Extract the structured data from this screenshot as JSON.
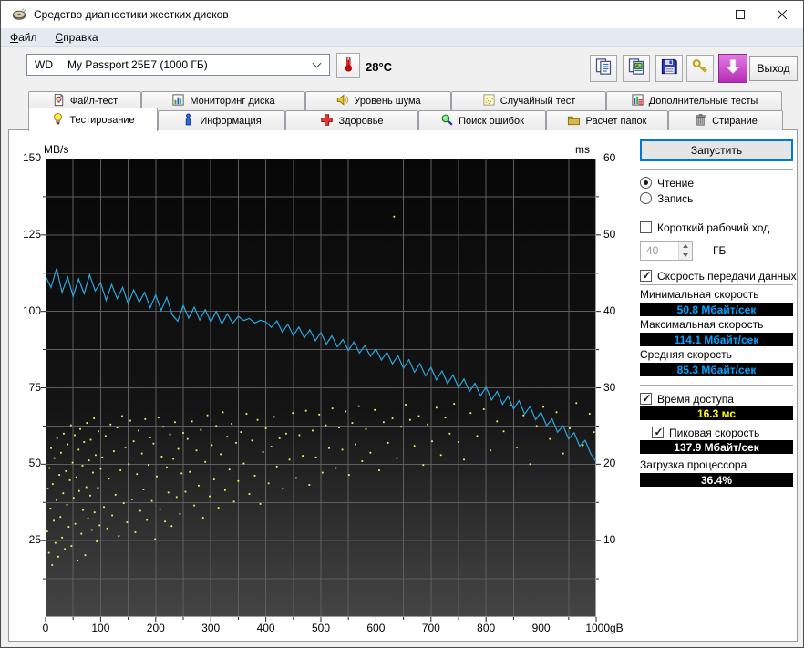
{
  "window": {
    "title": "Средство диагностики жестких дисков",
    "menu": [
      {
        "key": "Ф",
        "rest": "айл"
      },
      {
        "key": "С",
        "rest": "правка"
      }
    ]
  },
  "toolbar": {
    "drive": {
      "vendor": "WD",
      "model": "My Passport 25E7 (1000 ГБ)"
    },
    "temperature": "28°C",
    "buttons": [
      {
        "name": "copy-text-button",
        "icon": "copy-text-icon"
      },
      {
        "name": "copy-image-button",
        "icon": "copy-image-icon"
      },
      {
        "name": "save-button",
        "icon": "save-icon"
      },
      {
        "name": "keys-button",
        "icon": "keys-icon"
      },
      {
        "name": "download-button",
        "icon": "download-arrow-icon",
        "style": "magenta"
      }
    ],
    "exit_label": "Выход"
  },
  "tab_rows": [
    {
      "items": [
        {
          "label": "Файл-тест",
          "icon": "file-test-icon"
        },
        {
          "label": "Мониторинг диска",
          "icon": "disk-monitor-icon"
        },
        {
          "label": "Уровень шума",
          "icon": "noise-level-icon"
        },
        {
          "label": "Случайный тест",
          "icon": "random-test-icon"
        },
        {
          "label": "Дополнительные тесты",
          "icon": "extra-tests-icon"
        }
      ]
    },
    {
      "items": [
        {
          "label": "Тестирование",
          "icon": "benchmark-icon",
          "active": true
        },
        {
          "label": "Информация",
          "icon": "info-icon"
        },
        {
          "label": "Здоровье",
          "icon": "health-icon"
        },
        {
          "label": "Поиск ошибок",
          "icon": "error-scan-icon"
        },
        {
          "label": "Расчет папок",
          "icon": "folder-usage-icon"
        },
        {
          "label": "Стирание",
          "icon": "erase-icon"
        }
      ]
    }
  ],
  "controls": {
    "start_button": "Запустить",
    "mode": {
      "read": "Чтение",
      "write": "Запись",
      "read_selected": true,
      "write_selected": false
    },
    "short_stroke": {
      "label": "Короткий рабочий ход",
      "checked": false,
      "value": "40",
      "unit": "ГБ"
    },
    "transfer": {
      "label": "Скорость передачи данных",
      "checked": true,
      "min_label": "Минимальная скорость",
      "min_value": "50.8 Мбайт/сек",
      "max_label": "Максимальная скорость",
      "max_value": "114.1 Мбайт/сек",
      "avg_label": "Средняя скорость",
      "avg_value": "85.3 Мбайт/сек"
    },
    "access_time": {
      "label": "Время доступа",
      "checked": true,
      "value": "16.3 мс"
    },
    "burst": {
      "label": "Пиковая скорость",
      "checked": true,
      "value": "137.9 Мбайт/сек"
    },
    "cpu": {
      "label": "Загрузка процессора",
      "value": "36.4%"
    }
  },
  "colors": {
    "accent": "#0078d7",
    "speed_value": "#00a2ff",
    "access_value": "#ffff00",
    "white_value": "#ffffff",
    "plot_grid": "#5e5e5e"
  },
  "chart_data": {
    "type": "line+scatter",
    "x_axis": {
      "min": 0,
      "max": 1000,
      "tick_step": 100,
      "grid_step": 50,
      "tick_labels": [
        "0",
        "100",
        "200",
        "300",
        "400",
        "500",
        "600",
        "700",
        "800",
        "900",
        "1000gB"
      ]
    },
    "y_left": {
      "label": "MB/s",
      "min": 0,
      "max": 150,
      "grid_step": 12.5,
      "tick_values": [
        150,
        125,
        100,
        75,
        50,
        25
      ]
    },
    "y_right": {
      "label": "ms",
      "min": 0,
      "max": 60,
      "tick_values": [
        60,
        50,
        40,
        30,
        20,
        10
      ]
    },
    "series": [
      {
        "name": "transfer-rate",
        "unit": "MB/s",
        "color": "#2ba7df",
        "x_start": 0,
        "x_step": 10,
        "values": [
          111.5,
          107.8,
          114.1,
          106.2,
          111.3,
          104.9,
          110.6,
          105.8,
          112.0,
          106.7,
          109.4,
          103.6,
          108.8,
          104.2,
          107.9,
          102.4,
          107.0,
          103.0,
          106.2,
          101.2,
          105.4,
          100.3,
          104.6,
          98.9,
          96.8,
          102.0,
          97.8,
          101.4,
          97.2,
          100.6,
          96.5,
          100.0,
          95.9,
          99.2,
          96.1,
          98.4,
          97.0,
          97.7,
          96.2,
          97.1,
          96.6,
          94.8,
          96.9,
          93.2,
          95.8,
          92.1,
          94.9,
          91.3,
          94.0,
          90.4,
          93.1,
          89.3,
          92.0,
          88.4,
          90.8,
          87.2,
          90.0,
          86.4,
          88.8,
          85.3,
          87.7,
          84.1,
          86.6,
          82.8,
          85.5,
          81.4,
          84.2,
          80.1,
          82.9,
          78.9,
          81.7,
          77.6,
          80.5,
          76.4,
          79.2,
          75.1,
          77.9,
          73.8,
          76.5,
          72.4,
          75.2,
          71.0,
          73.8,
          69.6,
          72.3,
          68.1,
          70.8,
          66.4,
          68.9,
          64.6,
          67.0,
          62.6,
          64.8,
          60.5,
          62.6,
          58.2,
          60.3,
          55.9,
          57.8,
          53.4,
          50.8
        ]
      },
      {
        "name": "access-time",
        "unit": "ms",
        "color": "#f5f360",
        "points": [
          [
            3,
            11.2
          ],
          [
            4,
            16.8
          ],
          [
            6,
            8.4
          ],
          [
            7,
            19.5
          ],
          [
            9,
            14.2
          ],
          [
            10,
            22.1
          ],
          [
            12,
            6.8
          ],
          [
            13,
            17.4
          ],
          [
            15,
            12.6
          ],
          [
            16,
            20.8
          ],
          [
            18,
            9.7
          ],
          [
            20,
            15.3
          ],
          [
            21,
            23.4
          ],
          [
            23,
            7.9
          ],
          [
            25,
            18.6
          ],
          [
            27,
            13.1
          ],
          [
            28,
            21.5
          ],
          [
            30,
            10.4
          ],
          [
            32,
            16.2
          ],
          [
            33,
            24.0
          ],
          [
            35,
            8.9
          ],
          [
            37,
            19.1
          ],
          [
            39,
            14.7
          ],
          [
            40,
            22.6
          ],
          [
            42,
            11.8
          ],
          [
            44,
            17.9
          ],
          [
            46,
            25.1
          ],
          [
            47,
            9.3
          ],
          [
            49,
            20.2
          ],
          [
            51,
            15.6
          ],
          [
            53,
            23.8
          ],
          [
            54,
            12.2
          ],
          [
            56,
            18.3
          ],
          [
            58,
            7.4
          ],
          [
            60,
            21.9
          ],
          [
            61,
            16.5
          ],
          [
            63,
            24.6
          ],
          [
            65,
            10.9
          ],
          [
            67,
            19.8
          ],
          [
            68,
            14.0
          ],
          [
            70,
            22.9
          ],
          [
            72,
            8.1
          ],
          [
            74,
            17.0
          ],
          [
            75,
            25.4
          ],
          [
            77,
            12.9
          ],
          [
            79,
            20.5
          ],
          [
            81,
            15.9
          ],
          [
            82,
            23.2
          ],
          [
            84,
            11.4
          ],
          [
            86,
            18.9
          ],
          [
            88,
            26.0
          ],
          [
            89,
            13.7
          ],
          [
            91,
            21.2
          ],
          [
            93,
            9.9
          ],
          [
            95,
            16.9
          ],
          [
            96,
            24.3
          ],
          [
            98,
            12.0
          ],
          [
            100,
            19.4
          ],
          [
            103,
            20.9
          ],
          [
            106,
            14.4
          ],
          [
            109,
            23.7
          ],
          [
            112,
            11.6
          ],
          [
            115,
            18.1
          ],
          [
            118,
            25.2
          ],
          [
            121,
            13.3
          ],
          [
            124,
            21.7
          ],
          [
            127,
            16.0
          ],
          [
            130,
            24.8
          ],
          [
            133,
            10.6
          ],
          [
            136,
            19.2
          ],
          [
            139,
            26.3
          ],
          [
            142,
            14.9
          ],
          [
            145,
            22.2
          ],
          [
            148,
            12.4
          ],
          [
            151,
            20.0
          ],
          [
            154,
            25.7
          ],
          [
            157,
            15.4
          ],
          [
            160,
            23.0
          ],
          [
            163,
            11.1
          ],
          [
            166,
            18.7
          ],
          [
            169,
            24.4
          ],
          [
            172,
            13.9
          ],
          [
            175,
            21.4
          ],
          [
            178,
            16.7
          ],
          [
            181,
            25.9
          ],
          [
            184,
            12.7
          ],
          [
            187,
            19.9
          ],
          [
            190,
            23.5
          ],
          [
            193,
            15.2
          ],
          [
            196,
            22.7
          ],
          [
            199,
            10.2
          ],
          [
            202,
            18.4
          ],
          [
            205,
            26.1
          ],
          [
            208,
            14.1
          ],
          [
            211,
            21.0
          ],
          [
            214,
            24.9
          ],
          [
            217,
            12.5
          ],
          [
            220,
            19.6
          ],
          [
            223,
            16.3
          ],
          [
            226,
            23.9
          ],
          [
            229,
            11.9
          ],
          [
            232,
            20.7
          ],
          [
            235,
            25.5
          ],
          [
            238,
            15.7
          ],
          [
            241,
            22.0
          ],
          [
            244,
            13.5
          ],
          [
            247,
            18.8
          ],
          [
            250,
            24.1
          ],
          [
            254,
            16.4
          ],
          [
            258,
            23.3
          ],
          [
            262,
            19.0
          ],
          [
            266,
            25.6
          ],
          [
            270,
            14.6
          ],
          [
            274,
            21.8
          ],
          [
            278,
            17.2
          ],
          [
            282,
            24.5
          ],
          [
            286,
            13.0
          ],
          [
            290,
            20.3
          ],
          [
            294,
            26.4
          ],
          [
            298,
            15.8
          ],
          [
            302,
            22.5
          ],
          [
            306,
            18.0
          ],
          [
            310,
            25.0
          ],
          [
            314,
            14.3
          ],
          [
            318,
            21.3
          ],
          [
            322,
            26.8
          ],
          [
            326,
            16.6
          ],
          [
            330,
            23.6
          ],
          [
            334,
            19.3
          ],
          [
            338,
            25.3
          ],
          [
            342,
            15.1
          ],
          [
            346,
            22.8
          ],
          [
            350,
            17.8
          ],
          [
            355,
            24.2
          ],
          [
            360,
            20.1
          ],
          [
            365,
            26.6
          ],
          [
            370,
            16.1
          ],
          [
            375,
            23.1
          ],
          [
            380,
            18.5
          ],
          [
            385,
            25.8
          ],
          [
            390,
            14.8
          ],
          [
            395,
            21.6
          ],
          [
            400,
            24.7
          ],
          [
            405,
            17.5
          ],
          [
            410,
            22.3
          ],
          [
            415,
            26.2
          ],
          [
            420,
            19.7
          ],
          [
            425,
            23.4
          ],
          [
            431,
            16.8
          ],
          [
            437,
            24.0
          ],
          [
            443,
            20.6
          ],
          [
            449,
            26.7
          ],
          [
            455,
            18.2
          ],
          [
            461,
            23.8
          ],
          [
            467,
            21.1
          ],
          [
            473,
            27.0
          ],
          [
            479,
            17.3
          ],
          [
            485,
            24.4
          ],
          [
            491,
            20.9
          ],
          [
            497,
            26.5
          ],
          [
            503,
            18.9
          ],
          [
            509,
            25.1
          ],
          [
            515,
            22.1
          ],
          [
            521,
            27.3
          ],
          [
            527,
            19.5
          ],
          [
            533,
            24.8
          ],
          [
            539,
            21.9
          ],
          [
            545,
            26.9
          ],
          [
            551,
            18.6
          ],
          [
            557,
            25.4
          ],
          [
            563,
            22.6
          ],
          [
            569,
            27.6
          ],
          [
            575,
            20.4
          ],
          [
            582,
            24.6
          ],
          [
            590,
            21.5
          ],
          [
            598,
            27.1
          ],
          [
            606,
            19.2
          ],
          [
            614,
            25.5
          ],
          [
            622,
            22.8
          ],
          [
            630,
            26.0
          ],
          [
            633,
            52.4
          ],
          [
            638,
            20.8
          ],
          [
            646,
            24.9
          ],
          [
            654,
            27.8
          ],
          [
            662,
            25.8
          ],
          [
            670,
            22.4
          ],
          [
            678,
            26.3
          ],
          [
            686,
            19.9
          ],
          [
            694,
            25.2
          ],
          [
            702,
            23.0
          ],
          [
            710,
            27.4
          ],
          [
            718,
            21.2
          ],
          [
            726,
            26.1
          ],
          [
            734,
            24.0
          ],
          [
            742,
            27.9
          ],
          [
            750,
            22.9
          ],
          [
            760,
            20.6
          ],
          [
            772,
            26.7
          ],
          [
            784,
            23.7
          ],
          [
            796,
            27.2
          ],
          [
            808,
            21.8
          ],
          [
            820,
            25.6
          ],
          [
            832,
            24.3
          ],
          [
            844,
            27.7
          ],
          [
            856,
            22.2
          ],
          [
            868,
            26.4
          ],
          [
            880,
            20.0
          ],
          [
            892,
            25.0
          ],
          [
            904,
            27.5
          ],
          [
            916,
            23.3
          ],
          [
            928,
            26.8
          ],
          [
            940,
            21.4
          ],
          [
            952,
            24.7
          ],
          [
            964,
            28.0
          ],
          [
            976,
            22.5
          ],
          [
            988,
            26.6
          ],
          [
            996,
            24.2
          ]
        ]
      }
    ]
  }
}
